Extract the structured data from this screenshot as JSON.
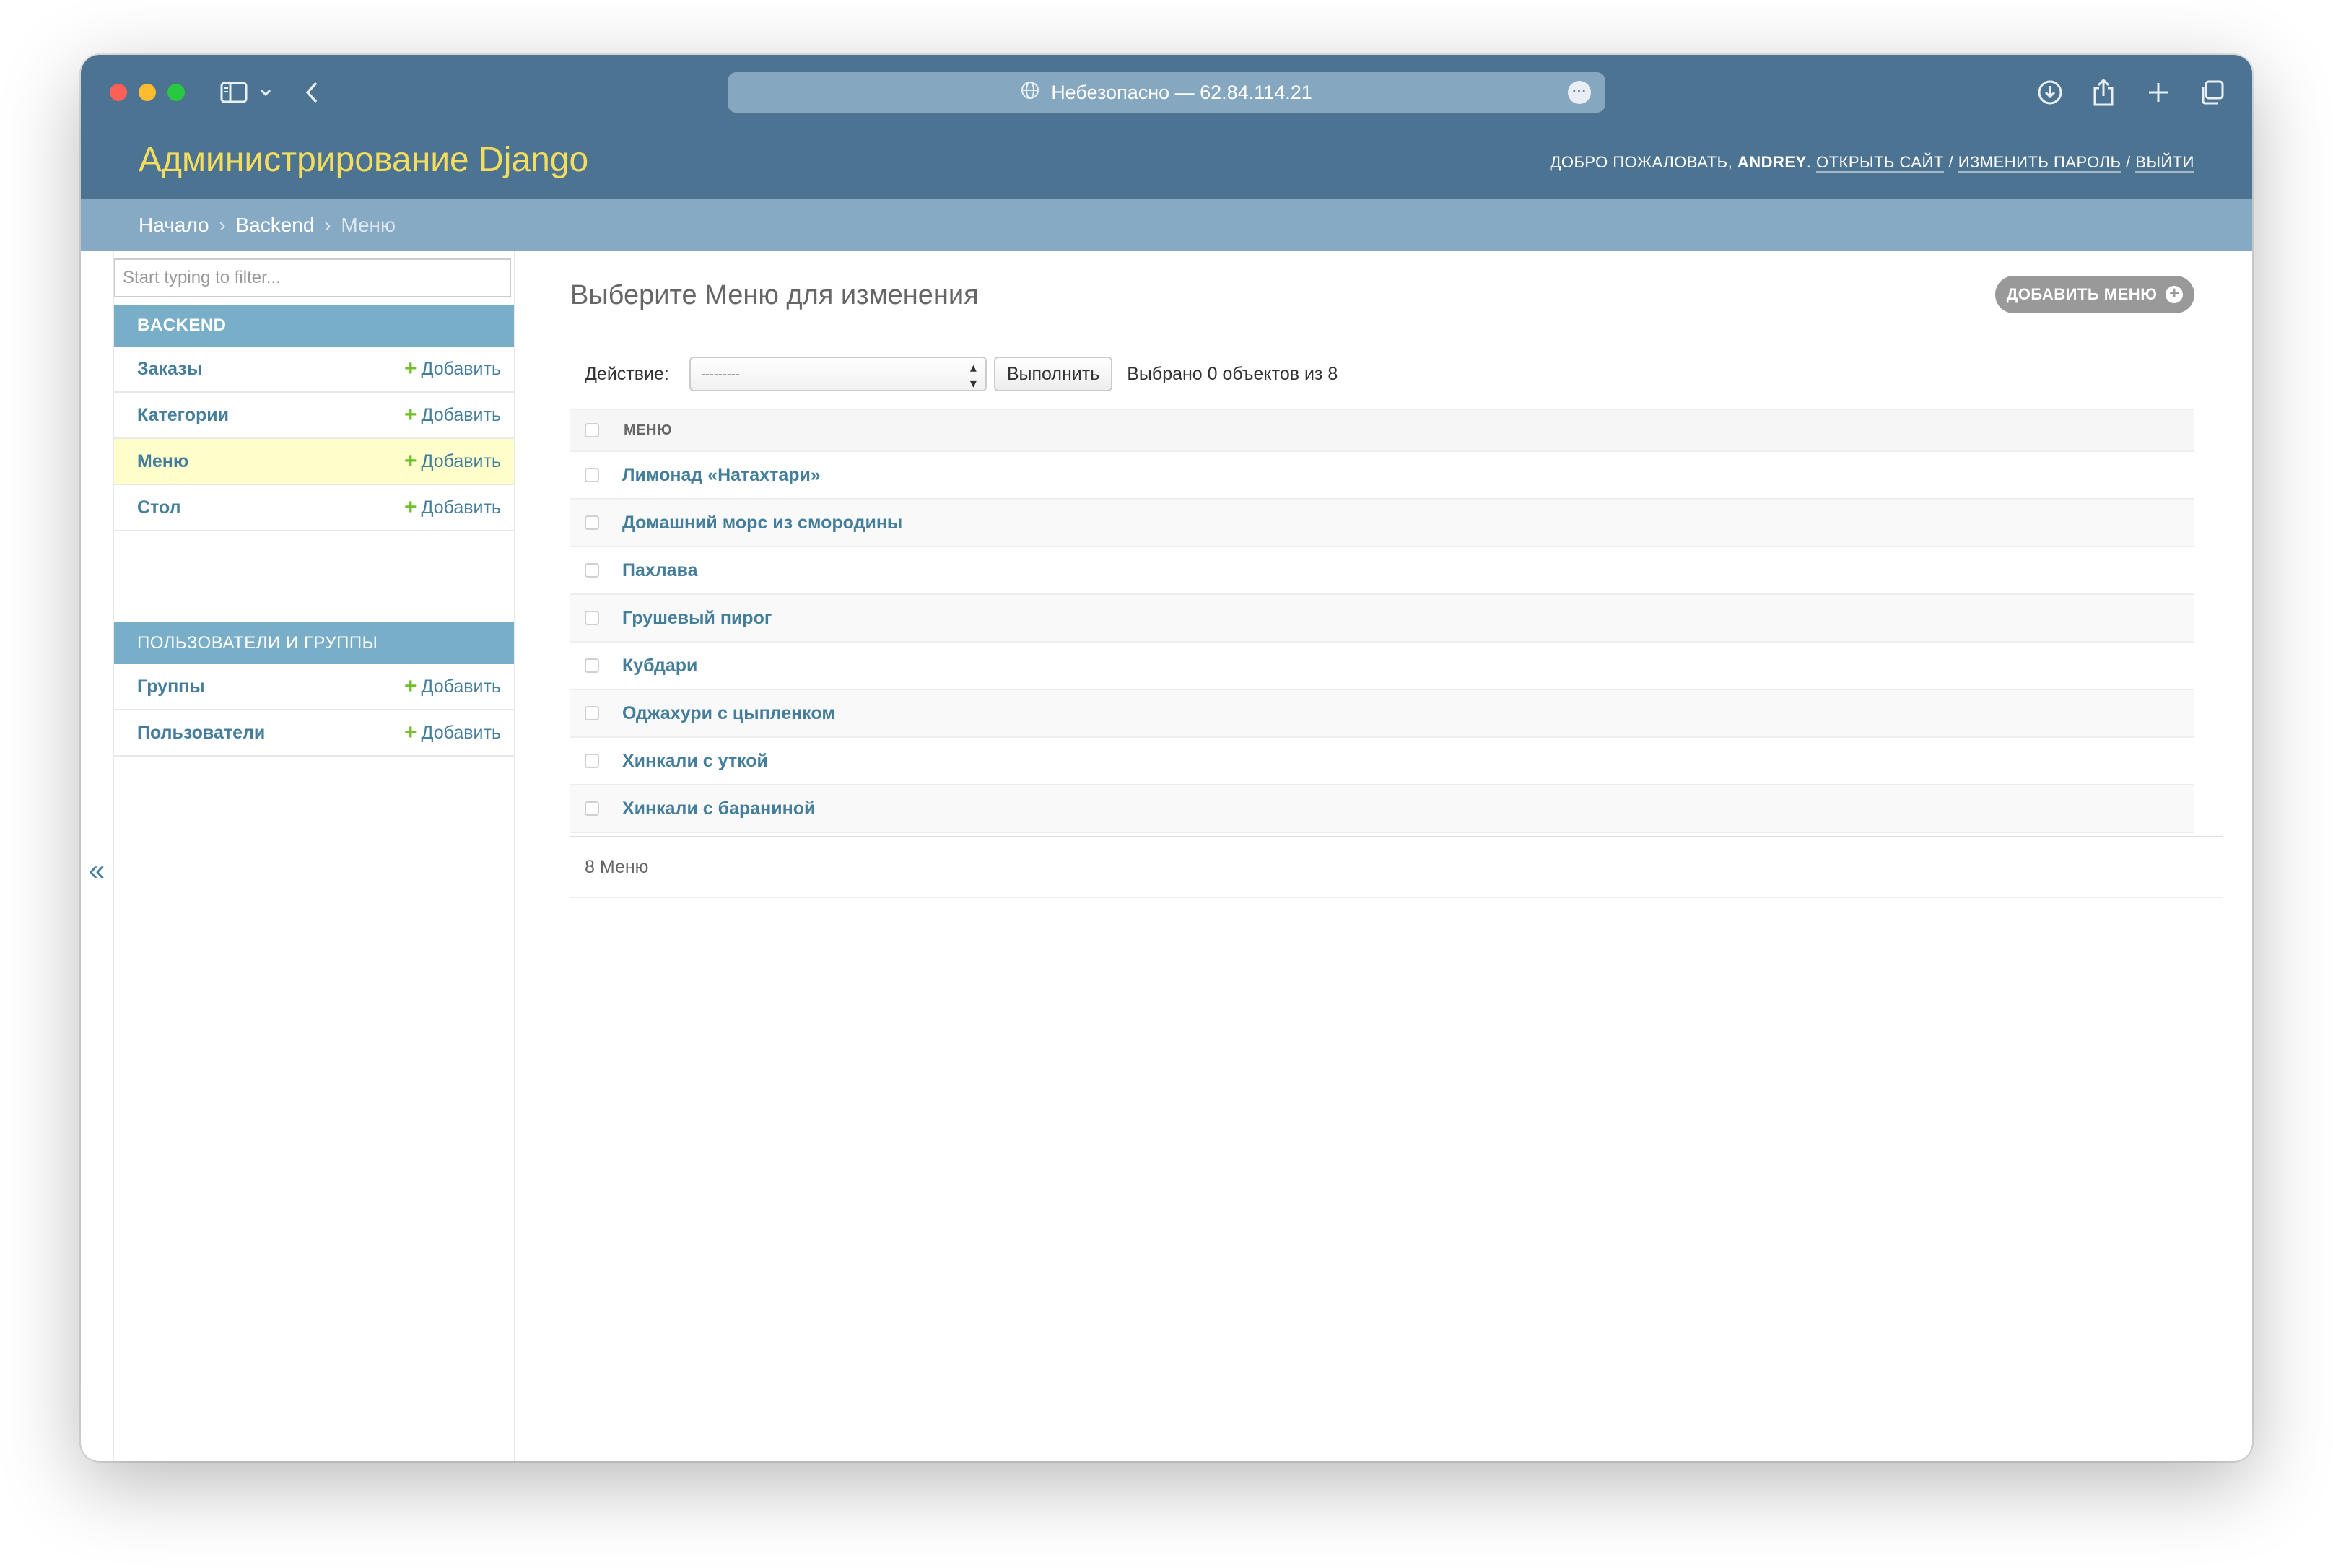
{
  "browser": {
    "address": "Небезопасно — 62.84.114.21"
  },
  "header": {
    "brand": "Администрирование Django",
    "welcome": "ДОБРО ПОЖАЛОВАТЬ,",
    "username": "ANDREY",
    "view_site": "ОТКРЫТЬ САЙТ",
    "change_password": "ИЗМЕНИТЬ ПАРОЛЬ",
    "logout": "ВЫЙТИ",
    "separator": "/"
  },
  "breadcrumbs": {
    "home": "Начало",
    "app": "Backend",
    "current": "Меню",
    "sep": "›"
  },
  "sidebar": {
    "filter_placeholder": "Start typing to filter...",
    "modules": [
      {
        "caption": "BACKEND",
        "items": [
          {
            "label": "Заказы",
            "add": "Добавить"
          },
          {
            "label": "Категории",
            "add": "Добавить"
          },
          {
            "label": "Меню",
            "add": "Добавить",
            "active": true
          },
          {
            "label": "Стол",
            "add": "Добавить"
          }
        ]
      },
      {
        "caption": "ПОЛЬЗОВАТЕЛИ И ГРУППЫ",
        "items": [
          {
            "label": "Группы",
            "add": "Добавить"
          },
          {
            "label": "Пользователи",
            "add": "Добавить"
          }
        ]
      }
    ],
    "collapse": "«"
  },
  "content": {
    "title": "Выберите Меню для изменения",
    "add_button": "ДОБАВИТЬ МЕНЮ",
    "action_label": "Действие:",
    "action_selected": "---------",
    "go_button": "Выполнить",
    "counter": "Выбрано 0 объектов из 8",
    "column_header": "МЕНЮ",
    "rows": [
      "Лимонад «Натахтари»",
      "Домашний морс из смородины",
      "Пахлава",
      "Грушевый пирог",
      "Кубдари",
      "Оджахури с цыпленком",
      "Хинкали с уткой",
      "Хинкали с бараниной"
    ],
    "paginator": "8 Меню"
  },
  "colors": {
    "header_bg": "#4c7391",
    "breadcrumb_bg": "#86a9c4",
    "module_caption_bg": "#79aec8",
    "link": "#447e9b",
    "brand": "#f5dd5d",
    "add_plus": "#70bf2b",
    "active_row": "#ffffcc"
  }
}
